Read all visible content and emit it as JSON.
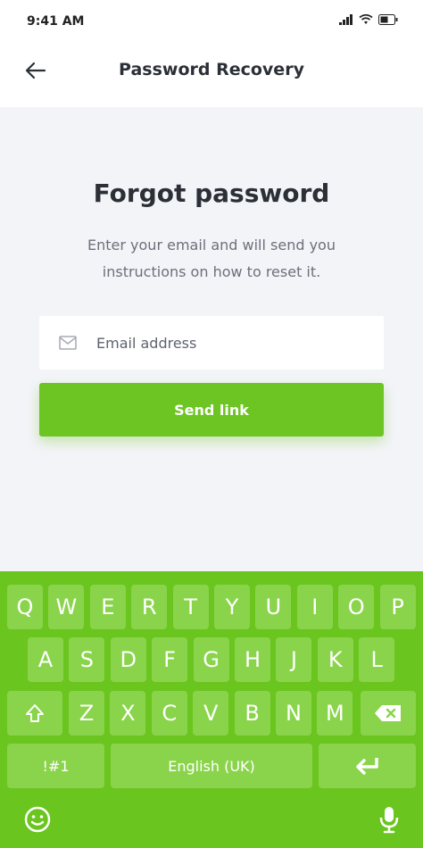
{
  "status_bar": {
    "time": "9:41 AM"
  },
  "nav": {
    "title": "Password Recovery",
    "back_icon": "arrow-left-icon"
  },
  "form": {
    "heading": "Forgot password",
    "description": "Enter your email and will send you instructions on how to reset it.",
    "email_placeholder": "Email address",
    "email_value": "",
    "send_label": "Send link"
  },
  "keyboard": {
    "row1": [
      "Q",
      "W",
      "E",
      "R",
      "T",
      "Y",
      "U",
      "I",
      "O",
      "P"
    ],
    "row2": [
      "A",
      "S",
      "D",
      "F",
      "G",
      "H",
      "J",
      "K",
      "L"
    ],
    "row3": [
      "Z",
      "X",
      "C",
      "V",
      "B",
      "N",
      "M"
    ],
    "symbols_label": "!#1",
    "space_label": "English (UK)"
  },
  "colors": {
    "accent": "#6cc522",
    "keyboard_bg": "#6ac51e",
    "key_bg": "#8ad44b",
    "content_bg": "#f3f4f8"
  }
}
